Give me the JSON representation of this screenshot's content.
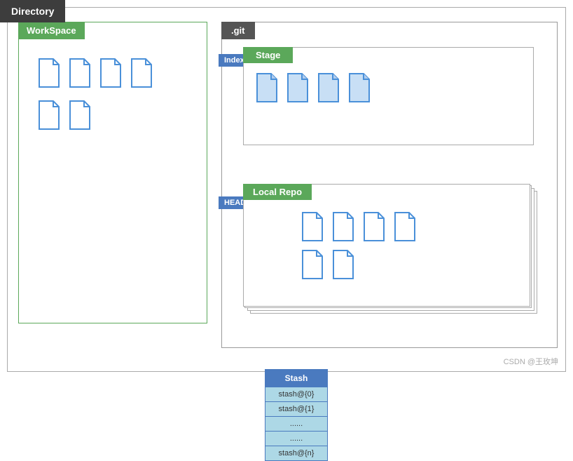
{
  "title": "Directory",
  "workspace": {
    "label": "WorkSpace",
    "files_row1_count": 4,
    "files_row2_count": 2
  },
  "git": {
    "label": ".git",
    "index_badge": "Index",
    "head_badge": "HEAD",
    "stage": {
      "label": "Stage",
      "files_count": 4
    },
    "local_repo": {
      "label": "Local Repo",
      "files_row1_count": 4,
      "files_row2_count": 2
    },
    "stash": {
      "header": "Stash",
      "items": [
        "stash@{0}",
        "stash@{1}",
        "......",
        "......",
        "stash@{n}"
      ]
    }
  },
  "watermark": "CSDN @王玫坤",
  "colors": {
    "green": "#5ba85a",
    "blue": "#4a7abf",
    "light_blue_file": "#4a90d9",
    "border": "#aaa",
    "dark_bg": "#3d3d3d",
    "git_bg": "#555"
  }
}
